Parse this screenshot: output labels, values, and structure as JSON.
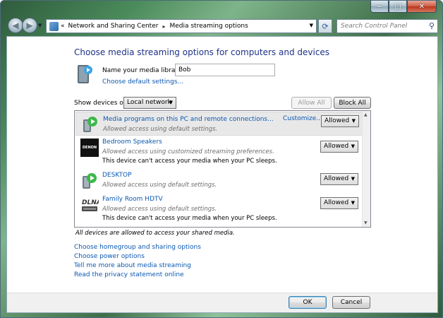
{
  "window": {
    "caption_buttons": {
      "minimize": "−",
      "maximize": "□",
      "close": "✕"
    }
  },
  "nav": {
    "back_icon": "back-arrow-icon",
    "forward_icon": "forward-arrow-icon",
    "breadcrumb_prefix": "«",
    "breadcrumb": [
      "Network and Sharing Center",
      "Media streaming options"
    ],
    "breadcrumb_separator": "▸",
    "search_placeholder": "Search Control Panel"
  },
  "main": {
    "heading": "Choose media streaming options for computers and devices",
    "library_label": "Name your media library:",
    "library_value": "Bob",
    "default_settings_link": "Choose default settings...",
    "show_devices_label": "Show devices on:",
    "show_devices_value": "Local network",
    "allow_all_label": "Allow All",
    "block_all_label": "Block All",
    "devices": [
      {
        "name": "Media programs on this PC and remote connections...",
        "status": "Allowed access using default settings.",
        "note": "",
        "action_link": "Customize...",
        "access": "Allowed",
        "icon": "media-player-icon"
      },
      {
        "name": "Bedroom Speakers",
        "status": "Allowed access using customized streaming preferences.",
        "note": "This device can't access your media when your PC sleeps.",
        "access": "Allowed",
        "icon": "denon-speaker-icon",
        "icon_text": "DENON"
      },
      {
        "name": "DESKTOP",
        "status": "Allowed access using default settings.",
        "note": "",
        "access": "Allowed",
        "icon": "media-player-icon"
      },
      {
        "name": "Family Room HDTV",
        "status": "Allowed access using default settings.",
        "note": "This device can't access your media when your PC sleeps.",
        "access": "Allowed",
        "icon": "dlna-tv-icon"
      }
    ],
    "all_devices_note": "All devices are allowed to access your shared media.",
    "links": [
      "Choose homegroup and sharing options",
      "Choose power options",
      "Tell me more about media streaming",
      "Read the privacy statement online"
    ]
  },
  "footer": {
    "ok_label": "OK",
    "cancel_label": "Cancel"
  }
}
